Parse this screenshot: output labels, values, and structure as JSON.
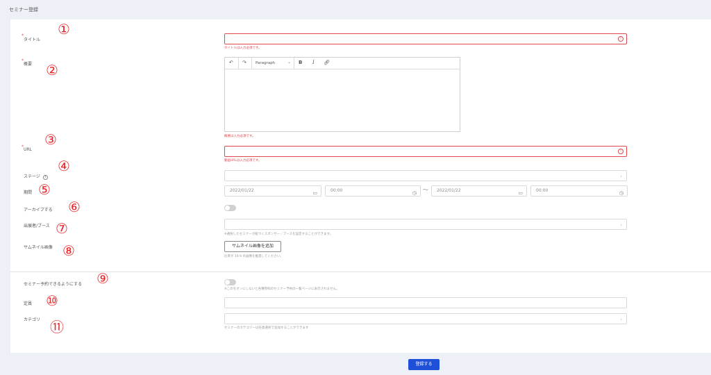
{
  "page_title": "セミナー登録",
  "markers": [
    "①",
    "②",
    "③",
    "④",
    "⑤",
    "⑥",
    "⑦",
    "⑧",
    "⑨",
    "⑩",
    "⑪"
  ],
  "fields": {
    "title": {
      "label": "タイトル",
      "error": "タイトルは入力必須です。"
    },
    "summary": {
      "label": "概要",
      "error": "概要は入力必須です。",
      "toolbar": {
        "undo_icon": "undo-icon",
        "redo_icon": "redo-icon",
        "format": "Paragraph",
        "bold": "B",
        "italic": "I",
        "link_icon": "link-icon"
      }
    },
    "url": {
      "label": "URL",
      "error": "動画URLは入力必須です。"
    },
    "stage": {
      "label": "ステージ",
      "help_icon": "question-circle-icon"
    },
    "period": {
      "label": "期間",
      "start_date": "2022/01/22",
      "start_time": "00:00",
      "separator": "〜",
      "end_date": "2022/01/22",
      "end_time": "00:00"
    },
    "archive": {
      "label": "アーカイブする",
      "on": false
    },
    "exhibitor": {
      "label": "出展者/ブース",
      "hint": "※選択したセミナーが紐づくスポンサー／ブースを設定することができます。"
    },
    "thumbnail": {
      "label": "サムネイル画像",
      "button": "サムネイル画像を追加",
      "hint": "比率が 16:9 の画像を推奨してください。"
    },
    "reservation": {
      "label": "セミナー予約できるようにする",
      "on": false,
      "hint": "※このをオンにしないと各種参照のセミナー予約の一覧ページに表示されません。"
    },
    "capacity": {
      "label": "定員"
    },
    "category": {
      "label": "カテゴリ",
      "hint": "セミナーのカテゴリーは任意選択で追加することができます"
    }
  },
  "submit_label": "登録する",
  "colors": {
    "error": "#e0494c",
    "marker": "#e8262a",
    "primary": "#1d4fd8",
    "background": "#eef0f7"
  }
}
